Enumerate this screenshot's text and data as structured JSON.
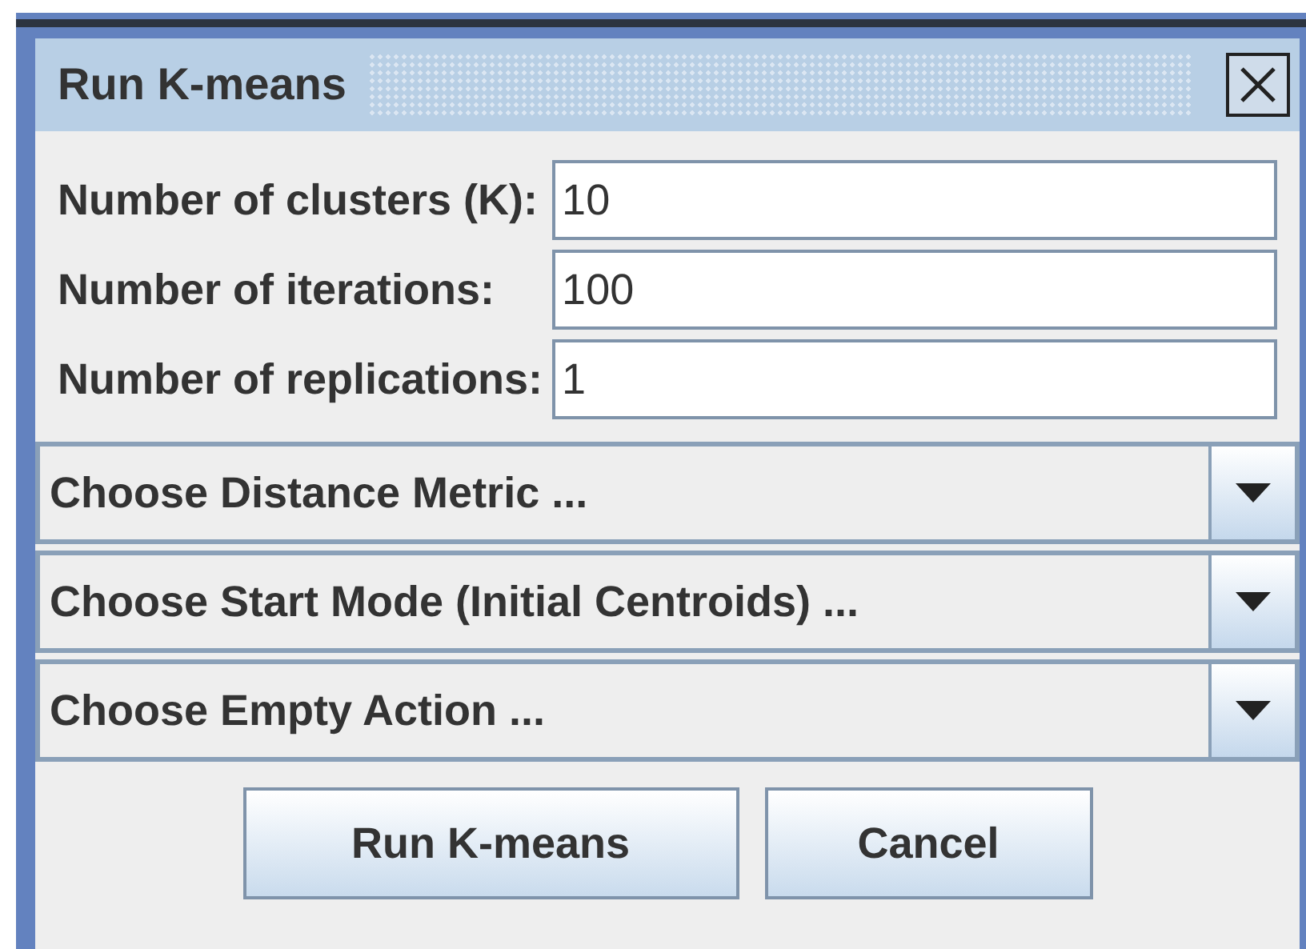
{
  "window": {
    "title": "Run K-means"
  },
  "fields": [
    {
      "label": "Number of clusters (K):",
      "value": "10"
    },
    {
      "label": "Number of iterations:",
      "value": "100"
    },
    {
      "label": "Number of replications:",
      "value": "1"
    }
  ],
  "dropdowns": [
    {
      "value": "Choose Distance Metric ..."
    },
    {
      "value": "Choose Start Mode (Initial Centroids) ..."
    },
    {
      "value": "Choose Empty Action ..."
    }
  ],
  "buttons": [
    {
      "label": "Run K-means"
    },
    {
      "label": "Cancel"
    }
  ]
}
